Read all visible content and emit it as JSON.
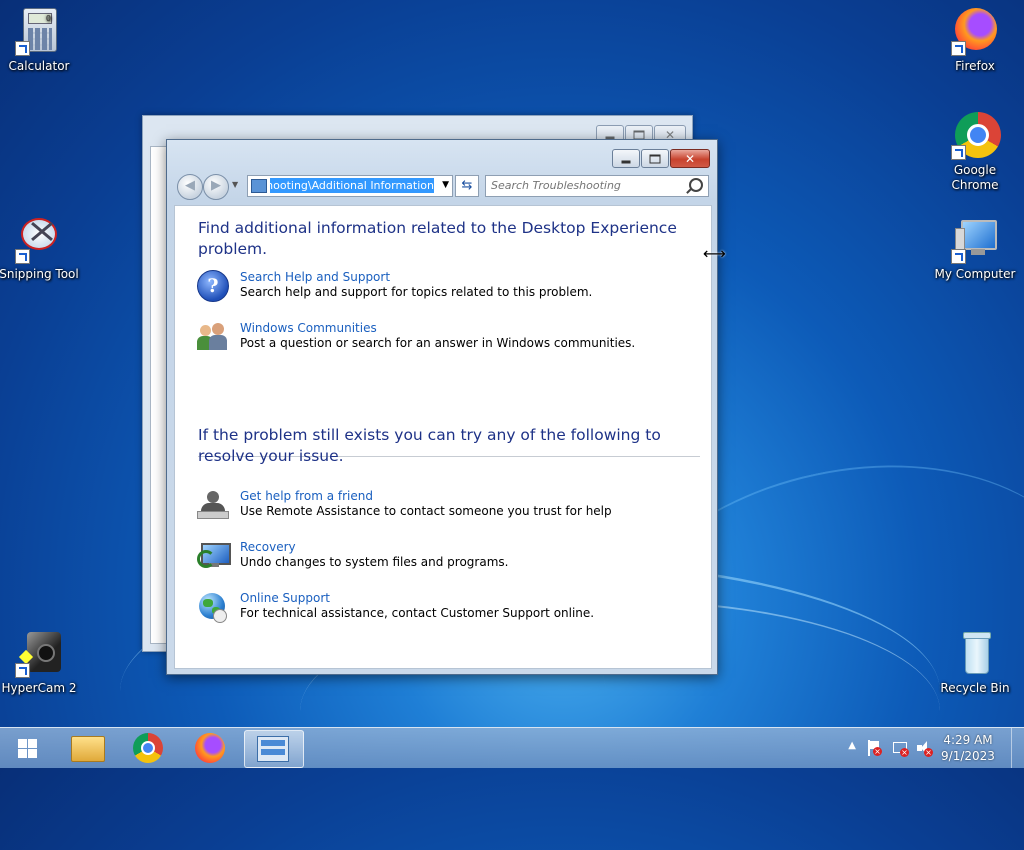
{
  "desktop": {
    "icons": [
      {
        "label": "Calculator"
      },
      {
        "label": "Snipping Tool"
      },
      {
        "label": "HyperCam 2"
      },
      {
        "label": "Firefox"
      },
      {
        "label": "Google Chrome"
      },
      {
        "label": "My Computer"
      },
      {
        "label": "Recycle Bin"
      }
    ]
  },
  "window": {
    "address_text": "Troubleshooting\\Additional Information",
    "search_placeholder": "Search Troubleshooting",
    "heading1": "Find additional information related to the Desktop Experience problem.",
    "section1_items": [
      {
        "icon": "help-icon",
        "title": "Search Help and Support",
        "desc": "Search help and support for topics related to this problem."
      },
      {
        "icon": "communities-icon",
        "title": "Windows Communities",
        "desc": "Post a question or search for an answer in Windows communities."
      }
    ],
    "heading2": "If the problem still exists you can try any of the following to resolve your issue.",
    "section2_items": [
      {
        "icon": "remote-assistance-icon",
        "title": "Get help from a friend",
        "desc": "Use Remote Assistance to contact someone you trust for help"
      },
      {
        "icon": "recovery-icon",
        "title": "Recovery",
        "desc": "Undo changes to system files and programs."
      },
      {
        "icon": "globe-icon",
        "title": "Online Support",
        "desc": "For technical assistance, contact Customer Support online."
      }
    ]
  },
  "taskbar": {
    "time": "4:29 AM",
    "date": "9/1/2023"
  }
}
